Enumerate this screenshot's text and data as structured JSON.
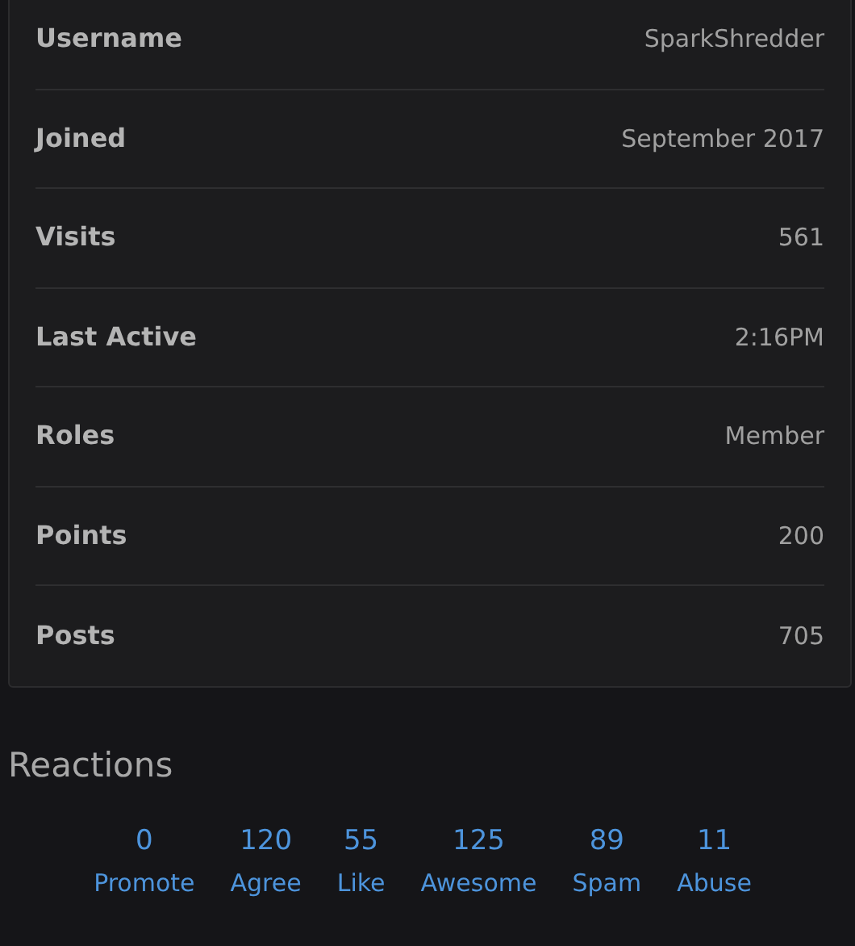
{
  "profile_fields": [
    {
      "label": "Username",
      "value": "SparkShredder"
    },
    {
      "label": "Joined",
      "value": "September 2017"
    },
    {
      "label": "Visits",
      "value": "561"
    },
    {
      "label": "Last Active",
      "value": "2:16PM"
    },
    {
      "label": "Roles",
      "value": "Member"
    },
    {
      "label": "Points",
      "value": "200"
    },
    {
      "label": "Posts",
      "value": "705"
    }
  ],
  "reactions": {
    "title": "Reactions",
    "items": [
      {
        "count": "0",
        "label": "Promote"
      },
      {
        "count": "120",
        "label": "Agree"
      },
      {
        "count": "55",
        "label": "Like"
      },
      {
        "count": "125",
        "label": "Awesome"
      },
      {
        "count": "89",
        "label": "Spam"
      },
      {
        "count": "11",
        "label": "Abuse"
      }
    ]
  }
}
